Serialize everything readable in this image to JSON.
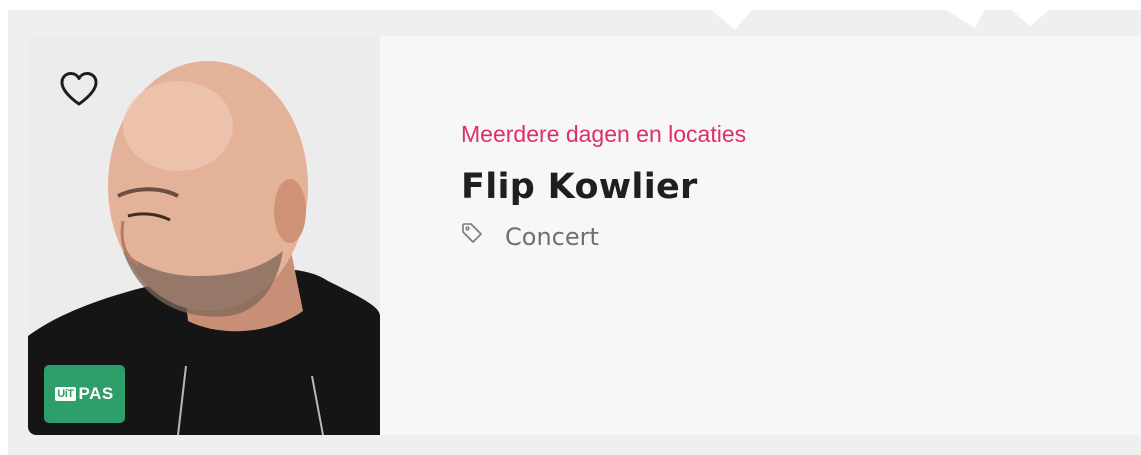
{
  "card": {
    "favorite_icon": "heart-outline-icon",
    "badge": {
      "prefix": "UiT",
      "label": "PAS",
      "color": "#2e9e6a"
    },
    "date_text": "Meerdere dagen en locaties",
    "title": "Flip Kowlier",
    "tag_icon": "tag-icon",
    "tag": "Concert",
    "accent_color": "#dc2f6a"
  }
}
